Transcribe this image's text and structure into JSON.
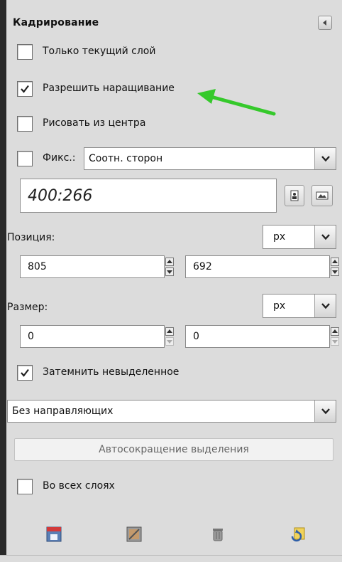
{
  "panel": {
    "title": "Кадрирование",
    "options": {
      "current_layer_only": {
        "label": "Только текущий слой",
        "checked": false
      },
      "allow_growing": {
        "label": "Разрешить наращивание",
        "checked": true
      },
      "expand_from_center": {
        "label": "Рисовать из центра",
        "checked": false
      },
      "fixed": {
        "label": "Фикс.:",
        "checked": false,
        "mode": "Соотн. сторон",
        "value": "400:266"
      }
    },
    "position": {
      "label": "Позиция:",
      "unit": "px",
      "x": "805",
      "y": "692"
    },
    "size": {
      "label": "Размер:",
      "unit": "px",
      "w": "0",
      "h": "0"
    },
    "highlight": {
      "label": "Затемнить невыделенное",
      "checked": true
    },
    "guides": {
      "value": "Без направляющих"
    },
    "auto_shrink_label": "Автосокращение выделения",
    "all_layers": {
      "label": "Во всех слоях",
      "checked": false
    }
  },
  "colors": {
    "annotation_arrow": "#35c92b"
  },
  "icons": [
    "collapse-icon",
    "portrait-icon",
    "landscape-icon",
    "save-preset-icon",
    "restore-preset-icon",
    "delete-preset-icon",
    "reset-icon"
  ]
}
